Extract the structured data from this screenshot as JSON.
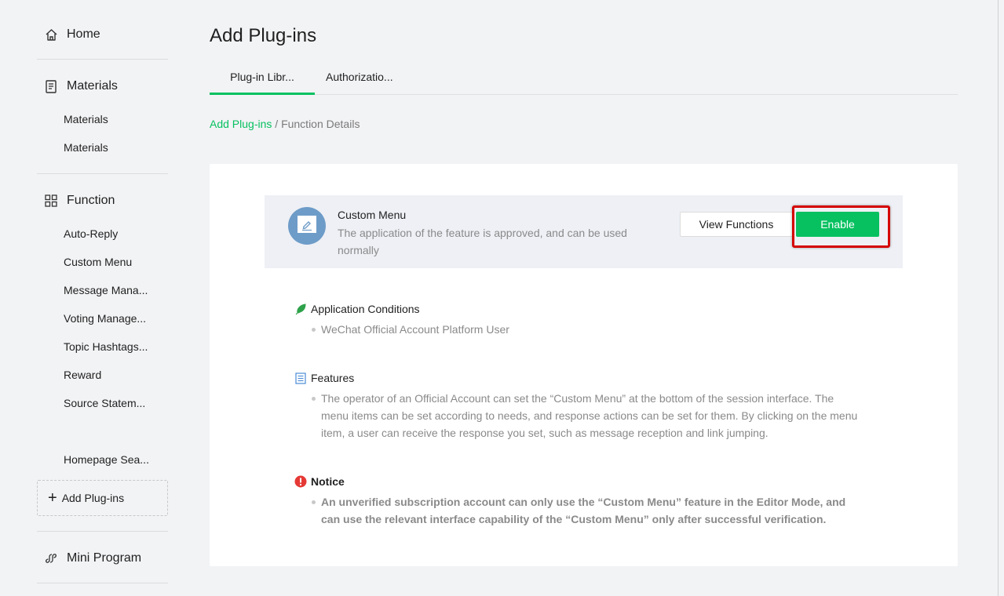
{
  "sidebar": {
    "home": "Home",
    "materials": {
      "title": "Materials",
      "items": [
        "Materials",
        "Materials"
      ]
    },
    "function": {
      "title": "Function",
      "items": [
        "Auto-Reply",
        "Custom Menu",
        "Message Mana...",
        "Voting Manage...",
        "Topic Hashtags...",
        "Reward",
        "Source Statem...",
        "Homepage Sea..."
      ]
    },
    "add_plugins": "Add Plug-ins",
    "mini_program": "Mini Program"
  },
  "main": {
    "title": "Add Plug-ins",
    "tabs": [
      {
        "label": "Plug-in Libr...",
        "active": true
      },
      {
        "label": "Authorizatio...",
        "active": false
      }
    ],
    "breadcrumb": {
      "link": "Add Plug-ins",
      "separator": " / ",
      "current": "Function Details"
    },
    "plugin": {
      "name": "Custom Menu",
      "description": "The application of the feature is approved, and can be used normally",
      "view_button": "View Functions",
      "enable_button": "Enable"
    },
    "sections": {
      "conditions": {
        "title": "Application Conditions",
        "items": [
          "WeChat Official Account Platform User"
        ]
      },
      "features": {
        "title": "Features",
        "items": [
          "The operator of an Official Account can set the “Custom Menu” at the bottom of the session interface. The menu items can be set according to needs, and response actions can be set for them. By clicking on the menu item, a user can receive the response you set, such as message reception and link jumping."
        ]
      },
      "notice": {
        "title": "Notice",
        "items": [
          "An unverified subscription account can only use the “Custom Menu” feature in the Editor Mode, and can use the relevant interface capability of the “Custom Menu” only after successful verification."
        ]
      }
    }
  },
  "colors": {
    "accent": "#07c160",
    "highlight": "#d50000",
    "notice": "#e53935",
    "avatar": "#6e9cc8"
  }
}
